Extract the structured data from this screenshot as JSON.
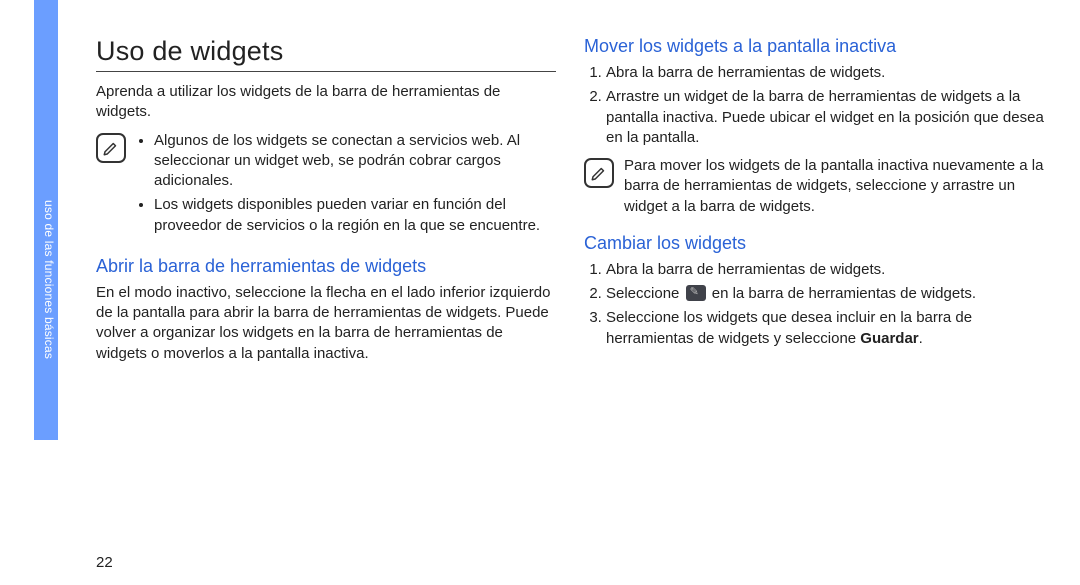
{
  "sidebar": {
    "tab_text": "uso de las funciones básicas"
  },
  "pagenum": "22",
  "col1": {
    "title": "Uso de widgets",
    "intro": "Aprenda a utilizar los widgets de la barra de herramientas de widgets.",
    "note_items": [
      "Algunos de los widgets se conectan a servicios web. Al seleccionar un widget web, se podrán cobrar cargos adicionales.",
      "Los widgets disponibles pueden variar en función del proveedor de servicios o la región en la que se encuentre."
    ],
    "section_a_title": "Abrir la barra de herramientas de widgets",
    "section_a_body": "En el modo inactivo, seleccione la flecha en el lado inferior izquierdo de la pantalla para abrir la barra de herramientas de widgets. Puede volver a organizar los widgets en la barra de herramientas de widgets o moverlos a la pantalla inactiva."
  },
  "col2": {
    "section_b_title": "Mover los widgets a la pantalla inactiva",
    "section_b_steps": [
      "Abra la barra de herramientas de widgets.",
      "Arrastre un widget de la barra de herramientas de widgets a la pantalla inactiva. Puede ubicar el widget en la posición que desea en la pantalla."
    ],
    "section_b_note": "Para mover los widgets de la pantalla inactiva nuevamente a la barra de herramientas de widgets, seleccione y arrastre un widget a la barra de widgets.",
    "section_c_title": "Cambiar los widgets",
    "section_c_step1": "Abra la barra de herramientas de widgets.",
    "section_c_step2_a": "Seleccione ",
    "section_c_step2_b": " en la barra de herramientas de widgets.",
    "section_c_step3_a": "Seleccione los widgets que desea incluir en la barra de herramientas de widgets y seleccione ",
    "section_c_step3_bold": "Guardar",
    "section_c_step3_b": "."
  }
}
